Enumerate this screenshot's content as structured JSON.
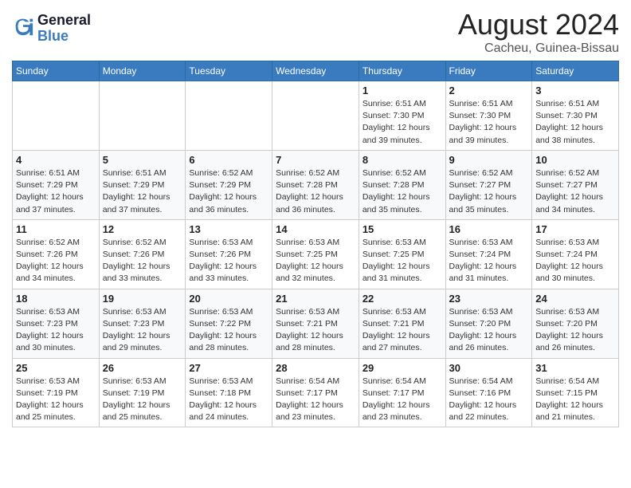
{
  "header": {
    "logo_line1": "General",
    "logo_line2": "Blue",
    "month_year": "August 2024",
    "location": "Cacheu, Guinea-Bissau"
  },
  "days_of_week": [
    "Sunday",
    "Monday",
    "Tuesday",
    "Wednesday",
    "Thursday",
    "Friday",
    "Saturday"
  ],
  "weeks": [
    [
      {
        "day": "",
        "info": ""
      },
      {
        "day": "",
        "info": ""
      },
      {
        "day": "",
        "info": ""
      },
      {
        "day": "",
        "info": ""
      },
      {
        "day": "1",
        "info": "Sunrise: 6:51 AM\nSunset: 7:30 PM\nDaylight: 12 hours\nand 39 minutes."
      },
      {
        "day": "2",
        "info": "Sunrise: 6:51 AM\nSunset: 7:30 PM\nDaylight: 12 hours\nand 39 minutes."
      },
      {
        "day": "3",
        "info": "Sunrise: 6:51 AM\nSunset: 7:30 PM\nDaylight: 12 hours\nand 38 minutes."
      }
    ],
    [
      {
        "day": "4",
        "info": "Sunrise: 6:51 AM\nSunset: 7:29 PM\nDaylight: 12 hours\nand 37 minutes."
      },
      {
        "day": "5",
        "info": "Sunrise: 6:51 AM\nSunset: 7:29 PM\nDaylight: 12 hours\nand 37 minutes."
      },
      {
        "day": "6",
        "info": "Sunrise: 6:52 AM\nSunset: 7:29 PM\nDaylight: 12 hours\nand 36 minutes."
      },
      {
        "day": "7",
        "info": "Sunrise: 6:52 AM\nSunset: 7:28 PM\nDaylight: 12 hours\nand 36 minutes."
      },
      {
        "day": "8",
        "info": "Sunrise: 6:52 AM\nSunset: 7:28 PM\nDaylight: 12 hours\nand 35 minutes."
      },
      {
        "day": "9",
        "info": "Sunrise: 6:52 AM\nSunset: 7:27 PM\nDaylight: 12 hours\nand 35 minutes."
      },
      {
        "day": "10",
        "info": "Sunrise: 6:52 AM\nSunset: 7:27 PM\nDaylight: 12 hours\nand 34 minutes."
      }
    ],
    [
      {
        "day": "11",
        "info": "Sunrise: 6:52 AM\nSunset: 7:26 PM\nDaylight: 12 hours\nand 34 minutes."
      },
      {
        "day": "12",
        "info": "Sunrise: 6:52 AM\nSunset: 7:26 PM\nDaylight: 12 hours\nand 33 minutes."
      },
      {
        "day": "13",
        "info": "Sunrise: 6:53 AM\nSunset: 7:26 PM\nDaylight: 12 hours\nand 33 minutes."
      },
      {
        "day": "14",
        "info": "Sunrise: 6:53 AM\nSunset: 7:25 PM\nDaylight: 12 hours\nand 32 minutes."
      },
      {
        "day": "15",
        "info": "Sunrise: 6:53 AM\nSunset: 7:25 PM\nDaylight: 12 hours\nand 31 minutes."
      },
      {
        "day": "16",
        "info": "Sunrise: 6:53 AM\nSunset: 7:24 PM\nDaylight: 12 hours\nand 31 minutes."
      },
      {
        "day": "17",
        "info": "Sunrise: 6:53 AM\nSunset: 7:24 PM\nDaylight: 12 hours\nand 30 minutes."
      }
    ],
    [
      {
        "day": "18",
        "info": "Sunrise: 6:53 AM\nSunset: 7:23 PM\nDaylight: 12 hours\nand 30 minutes."
      },
      {
        "day": "19",
        "info": "Sunrise: 6:53 AM\nSunset: 7:23 PM\nDaylight: 12 hours\nand 29 minutes."
      },
      {
        "day": "20",
        "info": "Sunrise: 6:53 AM\nSunset: 7:22 PM\nDaylight: 12 hours\nand 28 minutes."
      },
      {
        "day": "21",
        "info": "Sunrise: 6:53 AM\nSunset: 7:21 PM\nDaylight: 12 hours\nand 28 minutes."
      },
      {
        "day": "22",
        "info": "Sunrise: 6:53 AM\nSunset: 7:21 PM\nDaylight: 12 hours\nand 27 minutes."
      },
      {
        "day": "23",
        "info": "Sunrise: 6:53 AM\nSunset: 7:20 PM\nDaylight: 12 hours\nand 26 minutes."
      },
      {
        "day": "24",
        "info": "Sunrise: 6:53 AM\nSunset: 7:20 PM\nDaylight: 12 hours\nand 26 minutes."
      }
    ],
    [
      {
        "day": "25",
        "info": "Sunrise: 6:53 AM\nSunset: 7:19 PM\nDaylight: 12 hours\nand 25 minutes."
      },
      {
        "day": "26",
        "info": "Sunrise: 6:53 AM\nSunset: 7:19 PM\nDaylight: 12 hours\nand 25 minutes."
      },
      {
        "day": "27",
        "info": "Sunrise: 6:53 AM\nSunset: 7:18 PM\nDaylight: 12 hours\nand 24 minutes."
      },
      {
        "day": "28",
        "info": "Sunrise: 6:54 AM\nSunset: 7:17 PM\nDaylight: 12 hours\nand 23 minutes."
      },
      {
        "day": "29",
        "info": "Sunrise: 6:54 AM\nSunset: 7:17 PM\nDaylight: 12 hours\nand 23 minutes."
      },
      {
        "day": "30",
        "info": "Sunrise: 6:54 AM\nSunset: 7:16 PM\nDaylight: 12 hours\nand 22 minutes."
      },
      {
        "day": "31",
        "info": "Sunrise: 6:54 AM\nSunset: 7:15 PM\nDaylight: 12 hours\nand 21 minutes."
      }
    ]
  ]
}
